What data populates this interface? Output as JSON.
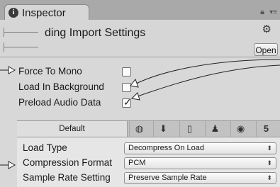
{
  "tab": {
    "title": "Inspector"
  },
  "header": {
    "title": "ding Import Settings",
    "open_label": "Open"
  },
  "options": [
    {
      "label": "Force To Mono",
      "checked": false
    },
    {
      "label": "Load In Background",
      "checked": false
    },
    {
      "label": "Preload Audio Data",
      "checked": true
    }
  ],
  "platforms": {
    "default_label": "Default",
    "icons": [
      "globe-icon",
      "download-icon",
      "phone-icon",
      "android-icon",
      "chrome-icon",
      "html5-icon"
    ]
  },
  "settings": [
    {
      "label": "Load Type",
      "value": "Decompress On Load"
    },
    {
      "label": "Compression Format",
      "value": "PCM"
    },
    {
      "label": "Sample Rate Setting",
      "value": "Preserve Sample Rate"
    }
  ]
}
